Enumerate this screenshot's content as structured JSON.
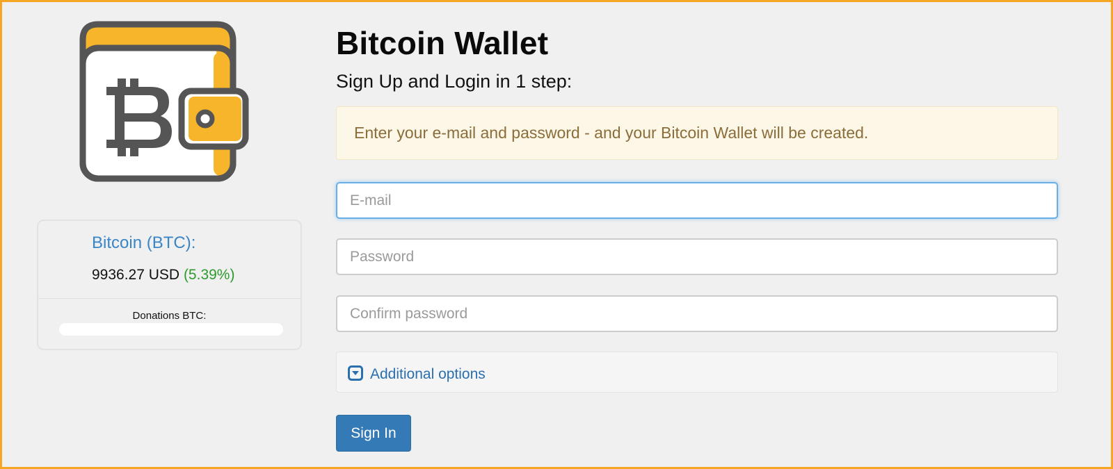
{
  "left": {
    "logo": {
      "icon": "bitcoin-wallet-icon",
      "colors": {
        "outline": "#555555",
        "accent": "#f7b52c",
        "fill": "#ffffff"
      }
    },
    "price": {
      "title": "Bitcoin (BTC):",
      "value": "9936.27 USD",
      "change": "(5.39%)",
      "donations_label": "Donations BTC:"
    }
  },
  "main": {
    "title": "Bitcoin Wallet",
    "subtitle": "Sign Up and Login in 1 step:",
    "alert": "Enter your e-mail and password - and your Bitcoin Wallet will be created.",
    "fields": {
      "email_placeholder": "E-mail",
      "password_placeholder": "Password",
      "confirm_placeholder": "Confirm password"
    },
    "options_label": "Additional options",
    "options_icon": "chevron-down-square-icon",
    "signin_label": "Sign In"
  },
  "colors": {
    "frame": "#f5a623",
    "accent_blue": "#337ab7",
    "link_blue": "#2a6fb0",
    "positive": "#2e9a2e",
    "alert_text": "#8a6d3b"
  }
}
